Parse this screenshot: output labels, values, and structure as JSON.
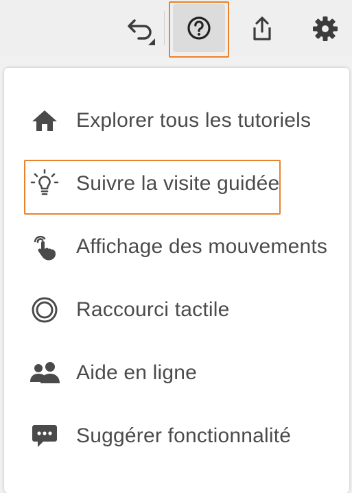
{
  "toolbar": {
    "undo_icon": "undo-icon",
    "help_icon": "help-circle-icon",
    "share_icon": "share-icon",
    "settings_icon": "gear-icon"
  },
  "menu": {
    "items": [
      {
        "label": "Explorer tous les tutoriels",
        "icon": "home-icon"
      },
      {
        "label": "Suivre la visite guidée",
        "icon": "lightbulb-icon"
      },
      {
        "label": "Affichage des mouvements",
        "icon": "touch-gesture-icon"
      },
      {
        "label": "Raccourci tactile",
        "icon": "touch-shortcut-icon"
      },
      {
        "label": "Aide en ligne",
        "icon": "users-icon"
      },
      {
        "label": "Suggérer fonctionnalité",
        "icon": "chat-bubble-icon"
      }
    ]
  },
  "colors": {
    "highlight": "#e8822e",
    "icon": "#4a4a4a",
    "text": "#4b4b4b"
  }
}
